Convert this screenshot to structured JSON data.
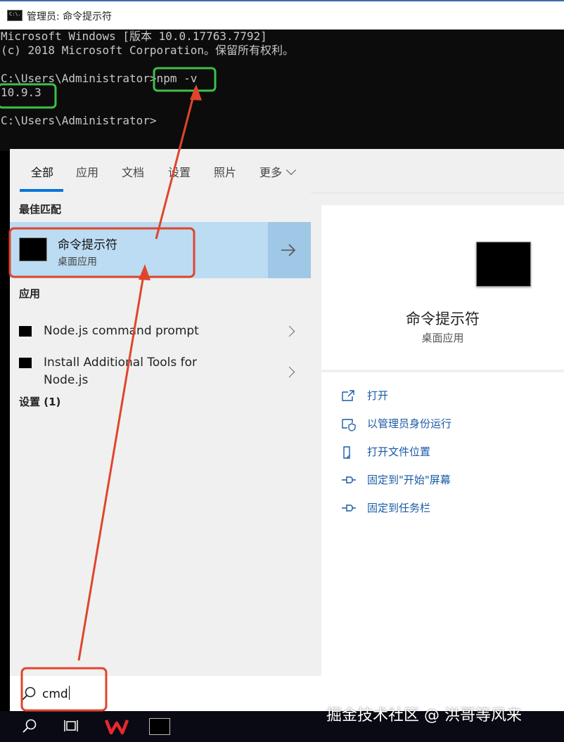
{
  "console": {
    "title": "管理员: 命令提示符",
    "title_icon_text": "C:\\.",
    "lines": [
      "Microsoft Windows [版本 10.0.17763.7792]",
      "(c) 2018 Microsoft Corporation。保留所有权利。",
      "",
      "C:\\Users\\Administrator>npm -v",
      "10.9.3",
      "",
      "C:\\Users\\Administrator>"
    ]
  },
  "search": {
    "tabs": [
      "全部",
      "应用",
      "文档",
      "设置",
      "照片",
      "更多"
    ],
    "best_match_heading": "最佳匹配",
    "best_match": {
      "title": "命令提示符",
      "subtitle": "桌面应用"
    },
    "apps_heading": "应用",
    "apps": [
      {
        "label": "Node.js command prompt"
      },
      {
        "label": "Install Additional Tools for Node.js"
      }
    ],
    "settings_heading": "设置 (1)",
    "query": "cmd",
    "preview": {
      "title": "命令提示符",
      "subtitle": "桌面应用",
      "actions": [
        {
          "label": "打开",
          "icon": "open-icon"
        },
        {
          "label": "以管理员身份运行",
          "icon": "shield-admin-icon"
        },
        {
          "label": "打开文件位置",
          "icon": "file-location-icon"
        },
        {
          "label": "固定到\"开始\"屏幕",
          "icon": "pin-icon"
        },
        {
          "label": "固定到任务栏",
          "icon": "pin-icon"
        }
      ]
    }
  },
  "taskbar": {
    "icons": [
      "search-icon",
      "task-view-icon",
      "wps-icon",
      "cmd-icon"
    ]
  },
  "watermark": "掘金技术社区 @ 洪哥等风来",
  "colors": {
    "accent": "#0a74d6",
    "highlight": "#bbdcf3",
    "annotation_red": "#e0452c",
    "annotation_green": "#3fbf4a",
    "link": "#1a5aa6"
  }
}
